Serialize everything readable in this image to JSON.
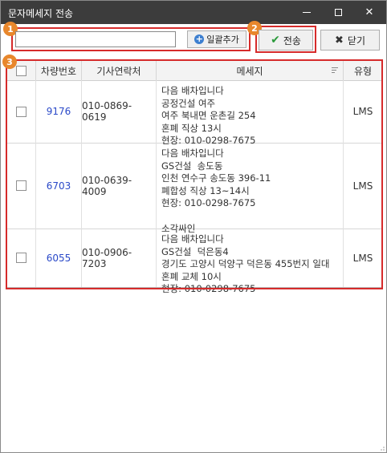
{
  "window": {
    "title": "문자메세지 전송",
    "controls": [
      "minimize-icon",
      "maximize-icon",
      "close-icon"
    ]
  },
  "badges": [
    "1",
    "2",
    "3"
  ],
  "toolbar": {
    "input_value": "",
    "bulk_add_label": "일괄추가",
    "send_label": "전송",
    "close_label": "닫기"
  },
  "grid": {
    "headers": [
      "",
      "차량번호",
      "기사연락처",
      "메세지",
      "유형"
    ],
    "rows": [
      {
        "checked": false,
        "car_no": "9176",
        "phone": "010-0869-0619",
        "message": "다음 배차입니다\n공정건설 여주\n여주 북내면 운촌길 254\n혼폐 직상 13시\n현장: 010-0298-7675",
        "type": "LMS"
      },
      {
        "checked": false,
        "car_no": "6703",
        "phone": "010-0639-4009",
        "message": "다음 배차입니다\nGS건설  송도동\n인천 연수구 송도동 396-11\n폐합성 직상 13~14시\n현장: 010-0298-7675\n\n소각싸인",
        "type": "LMS"
      },
      {
        "checked": false,
        "car_no": "6055",
        "phone": "010-0906-7203",
        "message": "다음 배차입니다\nGS건설  덕은동4\n경기도 고양시 덕양구 덕은동 455번지 일대\n혼폐 교체 10시\n현장: 010-0298-7675",
        "type": "LMS"
      }
    ]
  }
}
